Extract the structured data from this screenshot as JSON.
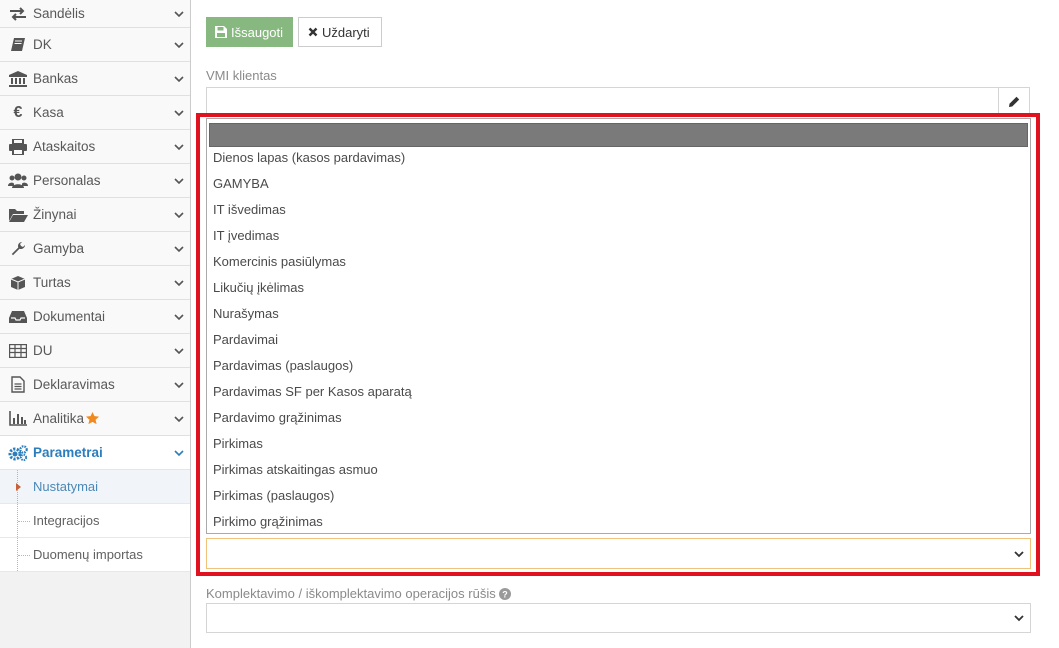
{
  "sidebar": {
    "items": [
      {
        "label": "Sandėlis",
        "icon": "exchange-icon"
      },
      {
        "label": "DK",
        "icon": "book-icon"
      },
      {
        "label": "Bankas",
        "icon": "bank-icon"
      },
      {
        "label": "Kasa",
        "icon": "euro-icon"
      },
      {
        "label": "Ataskaitos",
        "icon": "print-icon"
      },
      {
        "label": "Personalas",
        "icon": "users-icon"
      },
      {
        "label": "Žinynai",
        "icon": "folder-open-icon"
      },
      {
        "label": "Gamyba",
        "icon": "wrench-icon"
      },
      {
        "label": "Turtas",
        "icon": "cube-icon"
      },
      {
        "label": "Dokumentai",
        "icon": "inbox-icon"
      },
      {
        "label": "DU",
        "icon": "table-icon"
      },
      {
        "label": "Deklaravimas",
        "icon": "file-text-icon"
      },
      {
        "label": "Analitika",
        "icon": "bar-chart-icon"
      },
      {
        "label": "Parametrai",
        "icon": "cogs-icon"
      }
    ],
    "subitems": [
      {
        "label": "Nustatymai"
      },
      {
        "label": "Integracijos"
      },
      {
        "label": "Duomenų importas"
      }
    ]
  },
  "toolbar": {
    "save_label": "Išsaugoti",
    "close_label": "Uždaryti"
  },
  "form": {
    "vmi_client_label": "VMI klientas",
    "vmi_client_value": "",
    "dropdown_search_value": "",
    "dropdown_options": [
      "Dienos lapas (kasos pardavimas)",
      "GAMYBA",
      "IT išvedimas",
      "IT įvedimas",
      "Komercinis pasiūlymas",
      "Likučių įkėlimas",
      "Nurašymas",
      "Pardavimai",
      "Pardavimas (paslaugos)",
      "Pardavimas SF per Kasos aparatą",
      "Pardavimo grąžinimas",
      "Pirkimas",
      "Pirkimas atskaitingas asmuo",
      "Pirkimas (paslaugos)",
      "Pirkimo grąžinimas"
    ],
    "operation_select_value": "",
    "kit_label": "Komplektavimo / iškomplektavimo operacijos rūšis",
    "kit_select_value": ""
  },
  "colors": {
    "save_button": "#87b87f",
    "active_nav": "#2b7dbc",
    "highlight": "#e0121f",
    "select_focus_border": "#f0c27b",
    "star": "#f0891e"
  }
}
